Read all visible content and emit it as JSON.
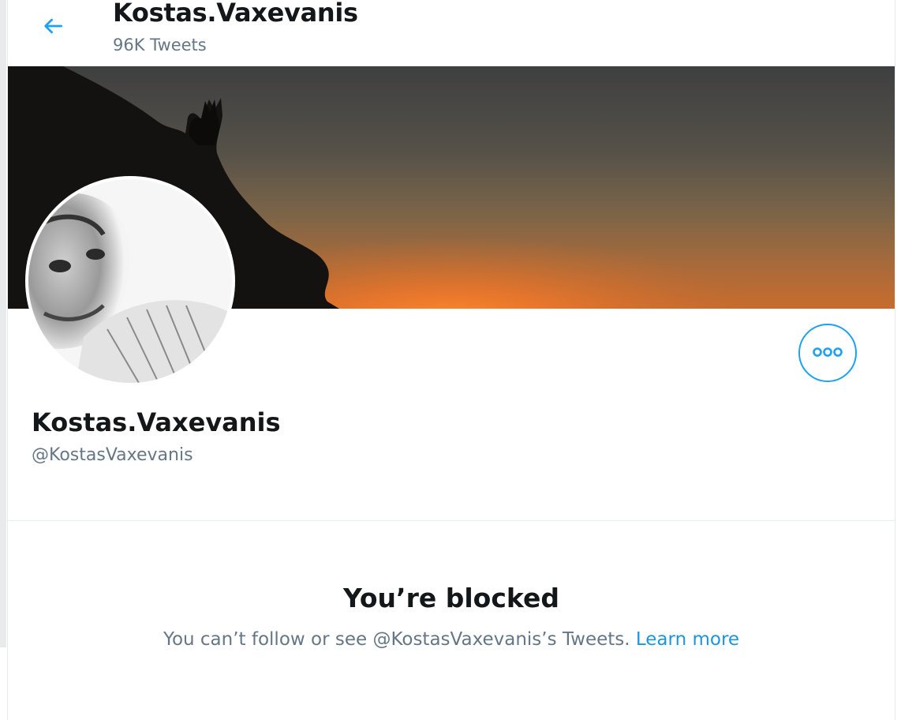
{
  "header": {
    "title": "Kostas.Vaxevanis",
    "tweet_count": "96K Tweets",
    "back_icon": "arrow-left-icon"
  },
  "profile": {
    "display_name": "Kostas.Vaxevanis",
    "handle": "@KostasVaxevanis",
    "more_icon": "ellipsis-icon"
  },
  "blocked": {
    "title": "You’re blocked",
    "message": "You can’t follow or see @KostasVaxevanis’s Tweets.",
    "link": "Learn more"
  },
  "colors": {
    "accent": "#1da1f2",
    "link": "#1b95e0",
    "secondary_text": "#657786",
    "border": "#e6ecf0"
  }
}
